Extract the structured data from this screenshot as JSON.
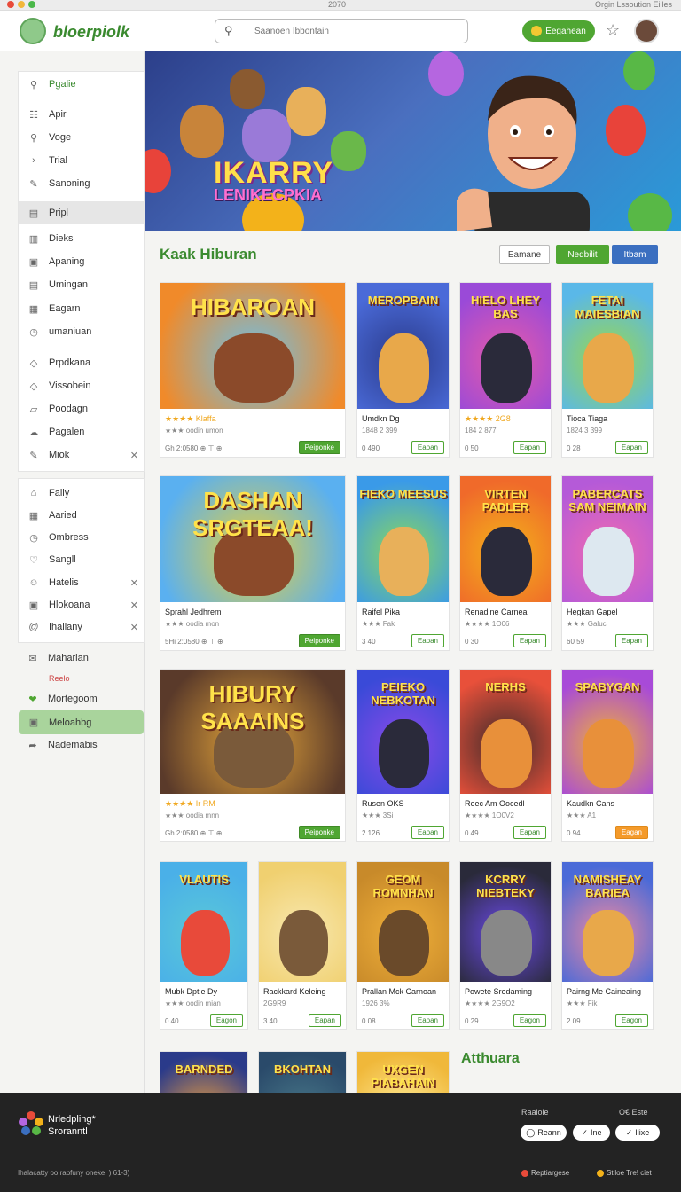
{
  "window": {
    "title": "2070",
    "right_text": "Orgin Lssoution Eilles"
  },
  "header": {
    "logo_text": "bloerpiolk",
    "search_placeholder": "Saanoen Ibbontain",
    "cta_label": "Eegahean",
    "icons": [
      "search-icon",
      "star-icon",
      "coin-icon"
    ]
  },
  "sidebar": {
    "group1": [
      {
        "label": "Pgalie",
        "icon": "search-icon",
        "active": true
      },
      {
        "label": "Apir",
        "icon": "grid-icon"
      },
      {
        "label": "Voge",
        "icon": "search-icon"
      },
      {
        "label": "Trial",
        "icon": "chevron-icon"
      },
      {
        "label": "Sanoning",
        "icon": "pen-icon"
      }
    ],
    "group2_header": "Pripl",
    "group2": [
      {
        "label": "Dieks",
        "icon": "image-icon"
      },
      {
        "label": "Apaning",
        "icon": "photo-icon"
      },
      {
        "label": "Umingan",
        "icon": "book-icon"
      },
      {
        "label": "Eagarn",
        "icon": "calendar-icon"
      },
      {
        "label": "umaniuan",
        "icon": "clock-icon"
      }
    ],
    "group3": [
      {
        "label": "Prpdkana",
        "icon": "tag-icon"
      },
      {
        "label": "Vissobein",
        "icon": "tag-icon"
      },
      {
        "label": "Poodagn",
        "icon": "folder-icon"
      },
      {
        "label": "Pagalen",
        "icon": "cloud-icon"
      },
      {
        "label": "Miok",
        "icon": "pen-icon",
        "closable": true
      }
    ],
    "group4": [
      {
        "label": "Fally",
        "icon": "home-icon"
      },
      {
        "label": "Aaried",
        "icon": "calendar-icon"
      },
      {
        "label": "Ombress",
        "icon": "clock-icon"
      },
      {
        "label": "Sangll",
        "icon": "heart-icon"
      },
      {
        "label": "Hatelis",
        "icon": "face-icon",
        "closable": true
      },
      {
        "label": "Hlokoana",
        "icon": "camera-icon",
        "closable": true
      },
      {
        "label": "Ihallany",
        "icon": "at-icon",
        "closable": true
      }
    ],
    "group5": [
      {
        "label": "Maharian",
        "icon": "mail-icon",
        "sub": "Reelo"
      },
      {
        "label": "Mortegoom",
        "icon": "check-heart-icon"
      },
      {
        "label": "Meloahbg",
        "icon": "square-icon",
        "active": true
      },
      {
        "label": "Nademabis",
        "icon": "share-icon"
      }
    ]
  },
  "banner": {
    "title": "IKARRY",
    "subtitle": "LENIKECPKIA"
  },
  "catalog": {
    "title": "Kaak Hiburan",
    "filters": [
      "Eamane",
      "Nedbilit",
      "Itbam"
    ]
  },
  "cards": [
    {
      "thumb": "HIBAROAN",
      "title": "Klaffa",
      "meta": "★★★★ Klaffa",
      "meta2": "★★★ oodin umon",
      "price": "Gh 2:0580  ⊕ ⊤ ⊕",
      "btn": "Peiponke"
    },
    {
      "thumb": "MEROPBAIN",
      "title": "Umdkn Dg",
      "meta2": "1848 2 399",
      "price": "0 490",
      "btn": "Eapan"
    },
    {
      "thumb": "HIELO LHEY BAS",
      "title": "2G8",
      "meta": "★★★★ 2G8",
      "meta2": "184 2 877",
      "price": "0 50",
      "btn": "Eapan"
    },
    {
      "thumb": "FETAI MAIESBIAN",
      "title": "Tioca Tiaga",
      "meta2": "1824 3 399",
      "price": "0 28",
      "btn": "Eapan"
    },
    {
      "thumb": "DASHAN SRGTEAA!",
      "title": "Sprahl Jedhrem",
      "meta2": "★★★ oodia mon",
      "price": "5Hi 2:0580  ⊕ ⊤ ⊕",
      "btn": "Peiponke"
    },
    {
      "thumb": "FIEKO MEESUS",
      "title": "Raifel Pika",
      "meta2": "★★★ Fak",
      "price": "3 40",
      "btn": "Eapan"
    },
    {
      "thumb": "VIRTEN PADLER",
      "title": "Renadine Carnea",
      "meta2": "★★★★ 1O06",
      "price": "0 30",
      "btn": "Eapan"
    },
    {
      "thumb": "PABERCATS SAM NEIMAIN",
      "title": "Hegkan Gapel",
      "meta2": "★★★ Galuc",
      "price": "60 59",
      "btn": "Eapan"
    },
    {
      "thumb": "HIBURY SAAAINS",
      "title": "RM",
      "meta": "★★★★ Ir RM",
      "meta2": "★★★ oodia mnn",
      "price": "Gh 2:0580  ⊕ ⊤ ⊕",
      "btn": "Peiponke"
    },
    {
      "thumb": "PEIEKO NEBKOTAN",
      "title": "Rusen OKS",
      "meta2": "★★★ 3Si",
      "price": "2 126",
      "btn": "Eapan"
    },
    {
      "thumb": "NERHS",
      "title": "Reec Am Oocedl",
      "meta2": "★★★★ 1O0V2",
      "price": "0 49",
      "btn": "Eapan"
    },
    {
      "thumb": "SPABYGAN",
      "title": "Kaudkn Cans",
      "meta2": "★★★ A1",
      "price": "0 94",
      "btn": "Eagan"
    },
    {
      "thumb": "VLAUTIS",
      "title": "Mubk Dptie Dy",
      "meta2": "★★★ oodin mian",
      "price": "0 40",
      "btn": "Eagon"
    },
    {
      "thumb": "",
      "title": "Rackkard Keleing",
      "meta2": "2G9R9",
      "price": "3 40",
      "btn": "Eapan"
    },
    {
      "thumb": "GEOM ROMNHAN",
      "title": "Prallan Mck Carnoan",
      "meta2": "1926 3% ",
      "price": "0 08",
      "btn": "Eapan"
    },
    {
      "thumb": "KCRRY NIEBTEKY",
      "title": "Powete Sredaming",
      "meta2": "★★★★ 2G9O2",
      "price": "0 29",
      "btn": "Eagon"
    },
    {
      "thumb": "NAMISHEAY BARIEA",
      "title": "Pairng Me Caineaing",
      "meta2": "★★★ Fik",
      "price": "2 09",
      "btn": "Eagon"
    },
    {
      "thumb": "BARNDED",
      "title": ""
    },
    {
      "thumb": "BKOHTAN",
      "title": ""
    },
    {
      "thumb": "UXGEN PIABAHAIN",
      "title": ""
    }
  ],
  "section2_title": "Atthuara",
  "footer": {
    "brand_line1": "Nrledpling*",
    "brand_line2": "Sroranntl",
    "copyright": "Ihalacatty oo rapfuny oneke! ) 61-3)",
    "link1": "Raaiole",
    "link2": "O€  Este",
    "pills": [
      "Reann",
      "Ine",
      "Ilixe"
    ],
    "bottom1": "Reptiargese",
    "bottom2": "Stiloe Tre! ciet"
  },
  "colors": {
    "brand_green": "#3a8a2f",
    "button_green": "#4fa632",
    "accent_blue": "#3b6fc0",
    "orange": "#f49a2a",
    "footer_bg": "#232323"
  }
}
